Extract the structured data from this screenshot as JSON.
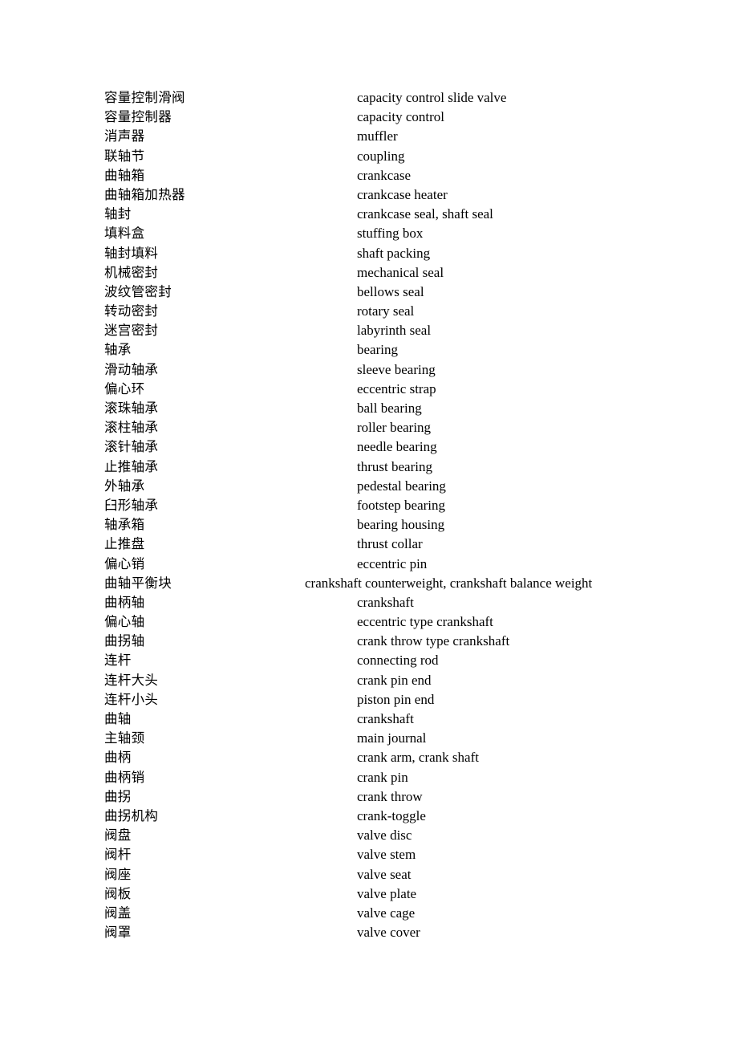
{
  "document": {
    "type": "bilingual-glossary",
    "background_color": "#ffffff",
    "text_color": "#000000",
    "entries": [
      {
        "term": "容量控制滑阀",
        "gloss": "capacity control slide valve",
        "wide": false
      },
      {
        "term": "容量控制器",
        "gloss": "capacity control",
        "wide": false
      },
      {
        "term": "消声器",
        "gloss": "muffler",
        "wide": false
      },
      {
        "term": "联轴节",
        "gloss": "coupling",
        "wide": false
      },
      {
        "term": "曲轴箱",
        "gloss": "crankcase",
        "wide": false
      },
      {
        "term": "曲轴箱加热器",
        "gloss": "crankcase heater",
        "wide": false
      },
      {
        "term": "轴封",
        "gloss": "crankcase seal, shaft seal",
        "wide": false
      },
      {
        "term": "填料盒",
        "gloss": "stuffing box",
        "wide": false
      },
      {
        "term": "轴封填料",
        "gloss": "shaft packing",
        "wide": false
      },
      {
        "term": "机械密封",
        "gloss": "mechanical seal",
        "wide": false
      },
      {
        "term": "波纹管密封",
        "gloss": "bellows seal",
        "wide": false
      },
      {
        "term": "转动密封",
        "gloss": "rotary seal",
        "wide": false
      },
      {
        "term": "迷宫密封",
        "gloss": "labyrinth seal",
        "wide": false
      },
      {
        "term": "轴承",
        "gloss": "bearing",
        "wide": false
      },
      {
        "term": "滑动轴承",
        "gloss": "sleeve bearing",
        "wide": false
      },
      {
        "term": "偏心环",
        "gloss": "eccentric strap",
        "wide": false
      },
      {
        "term": "滚珠轴承",
        "gloss": "ball bearing",
        "wide": false
      },
      {
        "term": "滚柱轴承",
        "gloss": "roller bearing",
        "wide": false
      },
      {
        "term": "滚针轴承",
        "gloss": "needle bearing",
        "wide": false
      },
      {
        "term": "止推轴承",
        "gloss": "thrust bearing",
        "wide": false
      },
      {
        "term": "外轴承",
        "gloss": "pedestal bearing",
        "wide": false
      },
      {
        "term": "臼形轴承",
        "gloss": "footstep bearing",
        "wide": false
      },
      {
        "term": "轴承箱",
        "gloss": "bearing housing",
        "wide": false
      },
      {
        "term": "止推盘",
        "gloss": "thrust collar",
        "wide": false
      },
      {
        "term": "偏心销",
        "gloss": "eccentric pin",
        "wide": false
      },
      {
        "term": "曲轴平衡块",
        "gloss": "crankshaft counterweight, crankshaft balance weight",
        "wide": true
      },
      {
        "term": "曲柄轴",
        "gloss": "crankshaft",
        "wide": false
      },
      {
        "term": "偏心轴",
        "gloss": "eccentric type crankshaft",
        "wide": false
      },
      {
        "term": "曲拐轴",
        "gloss": "crank throw type crankshaft",
        "wide": false
      },
      {
        "term": "连杆",
        "gloss": "connecting rod",
        "wide": false
      },
      {
        "term": "连杆大头",
        "gloss": "crank pin end",
        "wide": false
      },
      {
        "term": "连杆小头",
        "gloss": "piston pin end",
        "wide": false
      },
      {
        "term": "曲轴",
        "gloss": "crankshaft",
        "wide": false
      },
      {
        "term": "主轴颈",
        "gloss": "main journal",
        "wide": false
      },
      {
        "term": "曲柄",
        "gloss": "crank arm, crank shaft",
        "wide": false
      },
      {
        "term": "曲柄销",
        "gloss": "crank pin",
        "wide": false
      },
      {
        "term": "曲拐",
        "gloss": "crank throw",
        "wide": false
      },
      {
        "term": "曲拐机构",
        "gloss": "crank-toggle",
        "wide": false
      },
      {
        "term": "阀盘",
        "gloss": "valve disc",
        "wide": false
      },
      {
        "term": "阀杆",
        "gloss": "valve stem",
        "wide": false
      },
      {
        "term": "阀座",
        "gloss": "valve seat",
        "wide": false
      },
      {
        "term": "阀板",
        "gloss": "valve plate",
        "wide": false
      },
      {
        "term": "阀盖",
        "gloss": "valve cage",
        "wide": false
      },
      {
        "term": "阀罩",
        "gloss": "valve cover",
        "wide": false
      }
    ]
  }
}
